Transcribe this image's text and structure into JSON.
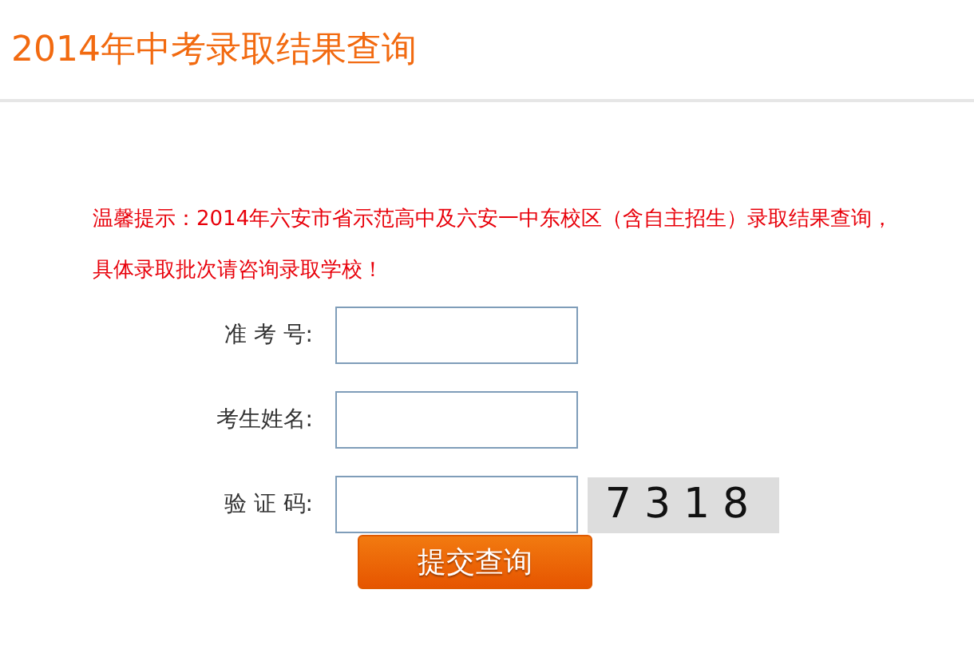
{
  "title": "2014年中考录取结果查询",
  "notice": "温馨提示：2014年六安市省示范高中及六安一中东校区（含自主招生）录取结果查询，具体录取批次请咨询录取学校！",
  "fields": [
    {
      "kind": "text",
      "label": "准 考 号:"
    },
    {
      "kind": "text",
      "label": "考生姓名:"
    },
    {
      "kind": "captcha",
      "label": "验 证 码:",
      "captcha": "7318"
    }
  ],
  "submit": "提交查询"
}
